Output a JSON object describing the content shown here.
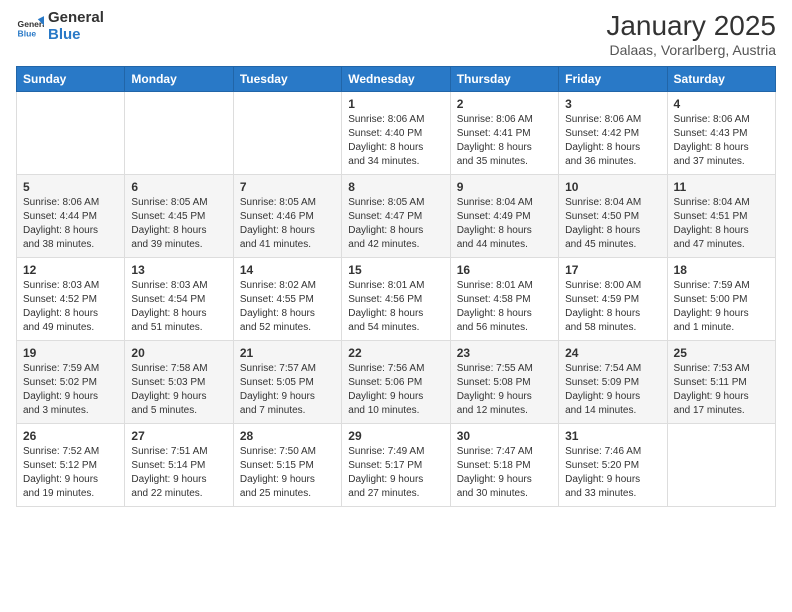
{
  "header": {
    "logo": {
      "general": "General",
      "blue": "Blue"
    },
    "month": "January 2025",
    "location": "Dalaas, Vorarlberg, Austria"
  },
  "weekdays": [
    "Sunday",
    "Monday",
    "Tuesday",
    "Wednesday",
    "Thursday",
    "Friday",
    "Saturday"
  ],
  "weeks": [
    [
      {
        "day": "",
        "info": ""
      },
      {
        "day": "",
        "info": ""
      },
      {
        "day": "",
        "info": ""
      },
      {
        "day": "1",
        "info": "Sunrise: 8:06 AM\nSunset: 4:40 PM\nDaylight: 8 hours\nand 34 minutes."
      },
      {
        "day": "2",
        "info": "Sunrise: 8:06 AM\nSunset: 4:41 PM\nDaylight: 8 hours\nand 35 minutes."
      },
      {
        "day": "3",
        "info": "Sunrise: 8:06 AM\nSunset: 4:42 PM\nDaylight: 8 hours\nand 36 minutes."
      },
      {
        "day": "4",
        "info": "Sunrise: 8:06 AM\nSunset: 4:43 PM\nDaylight: 8 hours\nand 37 minutes."
      }
    ],
    [
      {
        "day": "5",
        "info": "Sunrise: 8:06 AM\nSunset: 4:44 PM\nDaylight: 8 hours\nand 38 minutes."
      },
      {
        "day": "6",
        "info": "Sunrise: 8:05 AM\nSunset: 4:45 PM\nDaylight: 8 hours\nand 39 minutes."
      },
      {
        "day": "7",
        "info": "Sunrise: 8:05 AM\nSunset: 4:46 PM\nDaylight: 8 hours\nand 41 minutes."
      },
      {
        "day": "8",
        "info": "Sunrise: 8:05 AM\nSunset: 4:47 PM\nDaylight: 8 hours\nand 42 minutes."
      },
      {
        "day": "9",
        "info": "Sunrise: 8:04 AM\nSunset: 4:49 PM\nDaylight: 8 hours\nand 44 minutes."
      },
      {
        "day": "10",
        "info": "Sunrise: 8:04 AM\nSunset: 4:50 PM\nDaylight: 8 hours\nand 45 minutes."
      },
      {
        "day": "11",
        "info": "Sunrise: 8:04 AM\nSunset: 4:51 PM\nDaylight: 8 hours\nand 47 minutes."
      }
    ],
    [
      {
        "day": "12",
        "info": "Sunrise: 8:03 AM\nSunset: 4:52 PM\nDaylight: 8 hours\nand 49 minutes."
      },
      {
        "day": "13",
        "info": "Sunrise: 8:03 AM\nSunset: 4:54 PM\nDaylight: 8 hours\nand 51 minutes."
      },
      {
        "day": "14",
        "info": "Sunrise: 8:02 AM\nSunset: 4:55 PM\nDaylight: 8 hours\nand 52 minutes."
      },
      {
        "day": "15",
        "info": "Sunrise: 8:01 AM\nSunset: 4:56 PM\nDaylight: 8 hours\nand 54 minutes."
      },
      {
        "day": "16",
        "info": "Sunrise: 8:01 AM\nSunset: 4:58 PM\nDaylight: 8 hours\nand 56 minutes."
      },
      {
        "day": "17",
        "info": "Sunrise: 8:00 AM\nSunset: 4:59 PM\nDaylight: 8 hours\nand 58 minutes."
      },
      {
        "day": "18",
        "info": "Sunrise: 7:59 AM\nSunset: 5:00 PM\nDaylight: 9 hours\nand 1 minute."
      }
    ],
    [
      {
        "day": "19",
        "info": "Sunrise: 7:59 AM\nSunset: 5:02 PM\nDaylight: 9 hours\nand 3 minutes."
      },
      {
        "day": "20",
        "info": "Sunrise: 7:58 AM\nSunset: 5:03 PM\nDaylight: 9 hours\nand 5 minutes."
      },
      {
        "day": "21",
        "info": "Sunrise: 7:57 AM\nSunset: 5:05 PM\nDaylight: 9 hours\nand 7 minutes."
      },
      {
        "day": "22",
        "info": "Sunrise: 7:56 AM\nSunset: 5:06 PM\nDaylight: 9 hours\nand 10 minutes."
      },
      {
        "day": "23",
        "info": "Sunrise: 7:55 AM\nSunset: 5:08 PM\nDaylight: 9 hours\nand 12 minutes."
      },
      {
        "day": "24",
        "info": "Sunrise: 7:54 AM\nSunset: 5:09 PM\nDaylight: 9 hours\nand 14 minutes."
      },
      {
        "day": "25",
        "info": "Sunrise: 7:53 AM\nSunset: 5:11 PM\nDaylight: 9 hours\nand 17 minutes."
      }
    ],
    [
      {
        "day": "26",
        "info": "Sunrise: 7:52 AM\nSunset: 5:12 PM\nDaylight: 9 hours\nand 19 minutes."
      },
      {
        "day": "27",
        "info": "Sunrise: 7:51 AM\nSunset: 5:14 PM\nDaylight: 9 hours\nand 22 minutes."
      },
      {
        "day": "28",
        "info": "Sunrise: 7:50 AM\nSunset: 5:15 PM\nDaylight: 9 hours\nand 25 minutes."
      },
      {
        "day": "29",
        "info": "Sunrise: 7:49 AM\nSunset: 5:17 PM\nDaylight: 9 hours\nand 27 minutes."
      },
      {
        "day": "30",
        "info": "Sunrise: 7:47 AM\nSunset: 5:18 PM\nDaylight: 9 hours\nand 30 minutes."
      },
      {
        "day": "31",
        "info": "Sunrise: 7:46 AM\nSunset: 5:20 PM\nDaylight: 9 hours\nand 33 minutes."
      },
      {
        "day": "",
        "info": ""
      }
    ]
  ]
}
